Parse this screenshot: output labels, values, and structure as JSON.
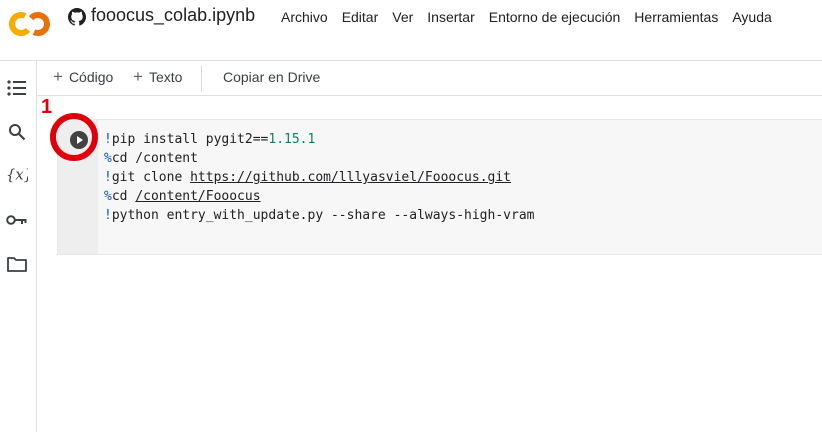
{
  "header": {
    "title": "fooocus_colab.ipynb",
    "menu": [
      "Archivo",
      "Editar",
      "Ver",
      "Insertar",
      "Entorno de ejecución",
      "Herramientas",
      "Ayuda"
    ]
  },
  "toolbar": {
    "code_label": "Código",
    "text_label": "Texto",
    "drive_label": "Copiar en Drive"
  },
  "annotation": {
    "number": "1"
  },
  "cell": {
    "lines": [
      {
        "prefix": "!",
        "text": "pip install pygit2==",
        "num": "1.15.1"
      },
      {
        "prefix": "%",
        "text": "cd /content"
      },
      {
        "prefix": "!",
        "text": "git clone ",
        "link": "https://github.com/lllyasviel/Fooocus.git"
      },
      {
        "prefix": "%",
        "text": "cd ",
        "link": "/content/Fooocus"
      },
      {
        "prefix": "!",
        "text": "python entry_with_update.py --share --always-high-vram"
      }
    ]
  },
  "colors": {
    "accent": "#f9ab00",
    "annotation": "#e0000b"
  }
}
